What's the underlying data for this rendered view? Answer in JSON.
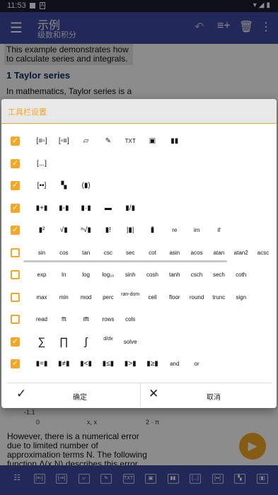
{
  "status_bar": {
    "time": "11:53"
  },
  "appbar": {
    "title": "示例",
    "subtitle": "级数和积分"
  },
  "doc": {
    "intro": "This example demonstrates how to calculate series and integrals.",
    "heading": "1  Taylor series",
    "para": "In mathematics, Taylor series is a",
    "axis_y": "-1.1",
    "axis_x0": "0",
    "axis_xmid": "x, x",
    "axis_xend": "2 · π",
    "bottom_text": "However, there is a numerical error due to limited number of approximation terms N. The following function Δ(x,N) describes this error."
  },
  "dialog": {
    "title": "工具栏设置",
    "ok_label": "确定",
    "cancel_label": "取消",
    "rows": [
      {
        "checked": true,
        "items": [
          "[≡▫]",
          "[▫≡]",
          "▱",
          "✎",
          "TXT",
          "▣",
          "▮▮"
        ]
      },
      {
        "checked": true,
        "items": [
          "[...]"
        ]
      },
      {
        "checked": true,
        "items": [
          "[▪▪]",
          "▚",
          "(▮)"
        ]
      },
      {
        "checked": true,
        "items": [
          "▮+▮",
          "▮-▮",
          "▮·▮",
          "▬",
          "▮/▮"
        ]
      },
      {
        "checked": true,
        "items": [
          "▮²",
          "√▮",
          "ⁿ√▮",
          "▮!",
          "|▮|",
          "▮̄",
          "re",
          "im",
          "if"
        ]
      },
      {
        "checked": false,
        "items": [
          "sin",
          "cos",
          "tan",
          "csc",
          "sec",
          "cot",
          "asin",
          "acos",
          "atan",
          "atan2",
          "acsc"
        ]
      },
      {
        "checked": false,
        "items": [
          "exp",
          "ln",
          "log",
          "log₁₀",
          "sinh",
          "cosh",
          "tanh",
          "csch",
          "sech",
          "coth"
        ]
      },
      {
        "checked": false,
        "items": [
          "max",
          "min",
          "mod",
          "perc",
          "ran-dom",
          "ceil",
          "floor",
          "round",
          "trunc",
          "sign"
        ]
      },
      {
        "checked": false,
        "items": [
          "read",
          "fft",
          "ifft",
          "rows",
          "cols"
        ]
      },
      {
        "checked": true,
        "items": [
          "∑",
          "∏",
          "∫",
          "d/dx",
          "solve"
        ]
      },
      {
        "checked": true,
        "items": [
          "▮=▮",
          "▮≠▮",
          "▮<▮",
          "▮≤▮",
          "▮>▮",
          "▮≥▮",
          "and",
          "or"
        ]
      }
    ]
  },
  "bottombar": {
    "items": [
      "☷",
      "[≡▫]",
      "[▫≡]",
      "▱",
      "✎",
      "TXT",
      "▣",
      "▮▮",
      "[...]",
      "[▪▪]",
      "▚",
      "(▮)",
      "▮+▮"
    ]
  },
  "colors": {
    "accent": "#f5a623",
    "primary": "#3f4aa0"
  }
}
